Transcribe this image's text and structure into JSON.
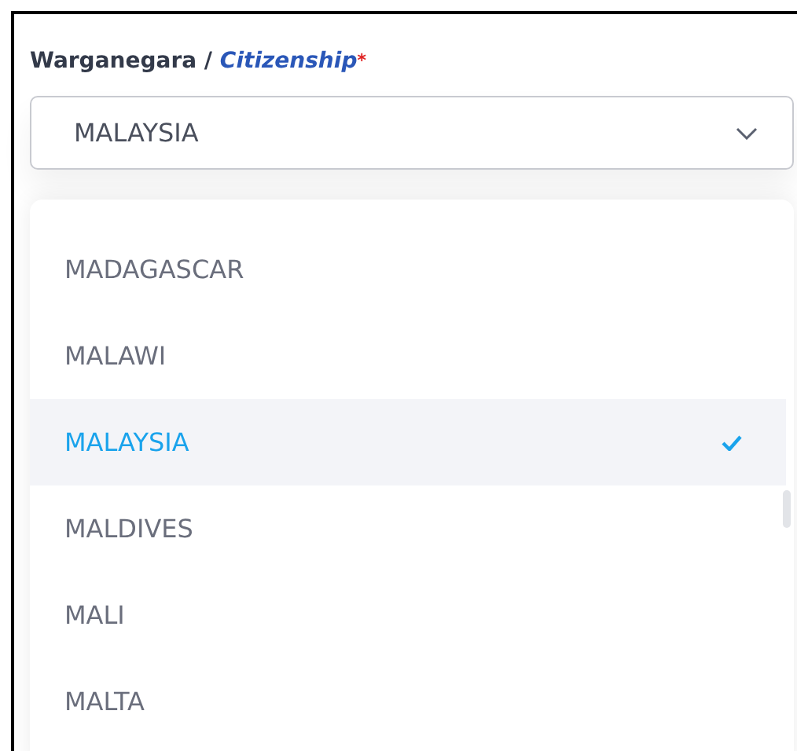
{
  "field": {
    "label": "Warganegara / ",
    "label_translation": "Citizenship",
    "required_mark": "*",
    "value": "MALAYSIA",
    "expanded": true
  },
  "options": [
    {
      "label": "MADAGASCAR",
      "selected": false
    },
    {
      "label": "MALAWI",
      "selected": false
    },
    {
      "label": "MALAYSIA",
      "selected": true
    },
    {
      "label": "MALDIVES",
      "selected": false
    },
    {
      "label": "MALI",
      "selected": false
    },
    {
      "label": "MALTA",
      "selected": false
    }
  ]
}
